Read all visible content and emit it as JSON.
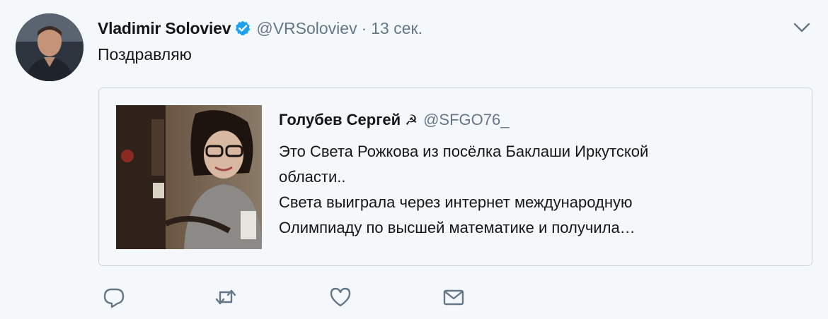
{
  "author": {
    "name": "Vladimir Soloviev",
    "handle": "@VRSoloviev",
    "separator": "·",
    "time": "13 сек."
  },
  "tweet": {
    "text": "Поздравляю"
  },
  "quoted": {
    "name": "Голубев Сергей",
    "emoji": "☭",
    "handle": "@SFGO76_",
    "lines": [
      "Это Света Рожкова из посёлка Баклаши Иркутской",
      "области..",
      "Света выиграла через интернет международную",
      "Олимпиаду по высшей математике и получила…"
    ]
  },
  "icons": {
    "verified": "verified-badge-icon",
    "menu": "chevron-down-icon",
    "reply": "reply-icon",
    "retweet": "retweet-icon",
    "like": "heart-icon",
    "message": "envelope-icon"
  },
  "colors": {
    "background": "#f5f8fa",
    "text": "#14171a",
    "secondary": "#657786",
    "verified": "#1da1f2",
    "border": "#ccd6dd"
  }
}
